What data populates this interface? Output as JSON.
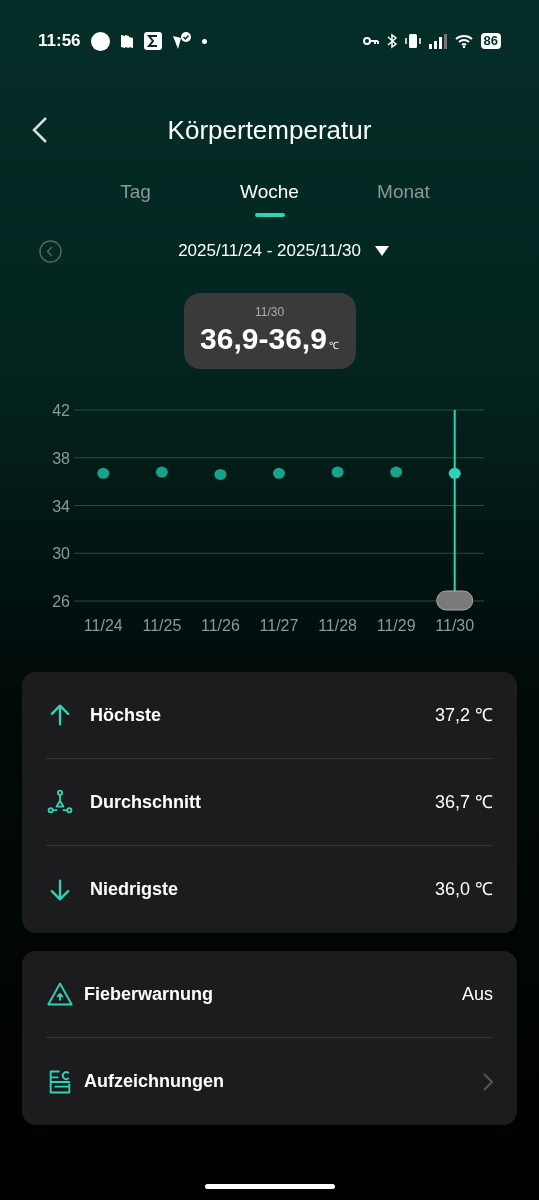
{
  "status_bar": {
    "time": "11:56",
    "battery": "86"
  },
  "header": {
    "title": "Körpertemperatur"
  },
  "tabs": [
    {
      "label": "Tag",
      "selected": false
    },
    {
      "label": "Woche",
      "selected": true
    },
    {
      "label": "Monat",
      "selected": false
    }
  ],
  "date_range": {
    "label": "2025/11/24 - 2025/11/30"
  },
  "tooltip": {
    "date": "11/30",
    "value": "36,9-36,9",
    "unit": "℃"
  },
  "chart": {
    "chart_data": {
      "type": "scatter",
      "categories": [
        "11/24",
        "11/25",
        "11/26",
        "11/27",
        "11/28",
        "11/29",
        "11/30"
      ],
      "values": [
        36.7,
        36.8,
        36.6,
        36.7,
        36.8,
        36.8,
        36.7
      ],
      "ylim": [
        26,
        42
      ],
      "yticks": [
        26,
        30,
        34,
        38,
        42
      ],
      "grid": true
    },
    "selection": [
      {
        "selected": false
      },
      {
        "selected": false
      },
      {
        "selected": false
      },
      {
        "selected": false
      },
      {
        "selected": false
      },
      {
        "selected": false
      },
      {
        "selected": true
      }
    ]
  },
  "stats": [
    {
      "kind": "up",
      "label": "Höchste",
      "value": "37,2 ℃"
    },
    {
      "kind": "average",
      "label": "Durchschnitt",
      "value": "36,7 ℃"
    },
    {
      "kind": "down",
      "label": "Niedrigste",
      "value": "36,0 ℃"
    }
  ],
  "settings": [
    {
      "kind": "warning",
      "label": "Fieberwarnung",
      "value": "Aus"
    },
    {
      "kind": "records",
      "label": "Aufzeichnungen"
    }
  ]
}
